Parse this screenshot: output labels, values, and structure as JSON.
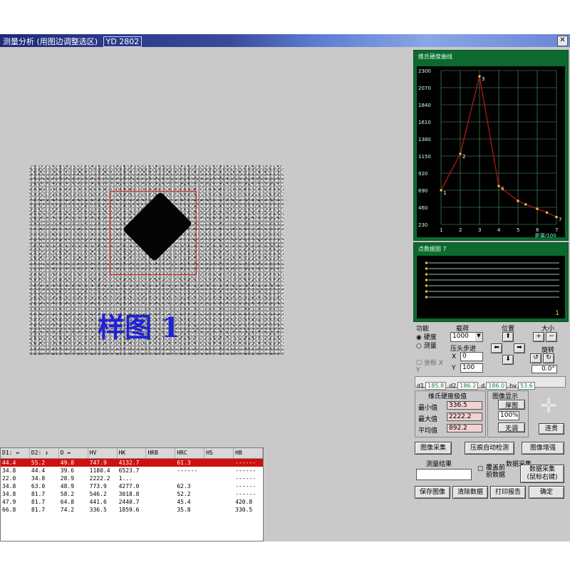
{
  "window": {
    "title": "测量分析 (用图边调整选区)",
    "model": "YD 2802",
    "close_label": "✕"
  },
  "sample": {
    "label": "样图 1"
  },
  "grid": {
    "columns": [
      "D1: ↔",
      "D2: ↕",
      "D ↔",
      "HV",
      "HK",
      "HRB",
      "HRC",
      "HS",
      "HB"
    ],
    "rows": [
      [
        "44.4",
        "55.2",
        "49.8",
        "747.9",
        "4132.7",
        "",
        "61.3",
        "",
        "------"
      ],
      [
        "34.8",
        "44.4",
        "39.6",
        "1180.4",
        "6523.7",
        "",
        "------",
        "",
        "------"
      ],
      [
        "22.0",
        "34.8",
        "28.9",
        "2222.2",
        "1...",
        "",
        "",
        "",
        "------"
      ],
      [
        "34.8",
        "63.0",
        "48.9",
        "773.9",
        "4277.0",
        "",
        "62.3",
        "",
        "------"
      ],
      [
        "34.8",
        "81.7",
        "58.2",
        "546.2",
        "3018.8",
        "",
        "52.2",
        "",
        "------"
      ],
      [
        "47.9",
        "81.7",
        "64.8",
        "441.6",
        "2440.7",
        "",
        "45.4",
        "",
        "420.8"
      ],
      [
        "66.8",
        "81.7",
        "74.2",
        "336.5",
        "1859.6",
        "",
        "35.8",
        "",
        "330.5"
      ]
    ]
  },
  "hardness_chart": {
    "caption": "维氏硬度曲线",
    "xlabel": "距离/100",
    "colors": {
      "panel": "#0c6a2e",
      "grid": "#4aa86a",
      "line": "#c01818",
      "point": "#f0d040"
    },
    "chart_data": {
      "type": "line",
      "x": [
        1,
        2,
        3,
        4,
        5,
        5.4,
        6,
        6.5,
        7
      ],
      "y": [
        690,
        1180,
        2222,
        748,
        546,
        500,
        440,
        390,
        330
      ],
      "point_labels": [
        "1",
        "2",
        "3",
        "4",
        "",
        "",
        "",
        "",
        "7"
      ],
      "xlim": [
        1,
        7
      ],
      "ylim": [
        230,
        2300
      ],
      "ytick_labels": [
        "2300",
        "2070",
        "1840",
        "1610",
        "1380",
        "1150",
        "920",
        "690",
        "460",
        "230"
      ],
      "xtick_labels": [
        "1",
        "2",
        "3",
        "4",
        "5",
        "6",
        "7"
      ],
      "grid": true
    }
  },
  "points_chart": {
    "caption": "点数据图 7",
    "corner_label": "1"
  },
  "controls": {
    "function_label": "功能",
    "radio_hardness": "硬度",
    "radio_measure": "测量",
    "load_label": "载荷",
    "load_value": "1000",
    "position_label": "位置",
    "size_label": "大小",
    "rotate_label": "旋转",
    "angle_value": "0.0°",
    "step_label": "压头步进",
    "step_x_label": "X",
    "step_x_value": "0",
    "step_y_label": "Y",
    "step_y_value": "100",
    "xy_label": "坐标 X Y"
  },
  "readouts": [
    {
      "label": "d1",
      "value": "185.8"
    },
    {
      "label": "d2",
      "value": "186.2"
    },
    {
      "label": "d",
      "value": "186.0"
    },
    {
      "label": "hv",
      "value": "53.6"
    }
  ],
  "stats": {
    "title": "维氏硬度极值",
    "min_label": "最小值",
    "min_value": "336.5",
    "max_label": "最大值",
    "max_value": "2222.2",
    "avg_label": "平均值",
    "avg_value": "892.2"
  },
  "display": {
    "title": "图像显示",
    "mode_thickness": "厚图",
    "zoom_value": "100%",
    "mode_none": "无调",
    "link_button": "连贯"
  },
  "buttons": {
    "capture": "图像采集",
    "auto_measure": "压痕自动检测",
    "image_enhance": "图像增强",
    "measure_result": "测量结果",
    "data_collect": "数据采集",
    "collect_two_line1": "数据采集",
    "collect_two_line2": "(鼠标右键)",
    "checkbox_label1": "覆盖前",
    "checkbox_label2": "前数据",
    "save_image": "保存图像",
    "clear_data": "清除数据",
    "print_report": "打印报告",
    "ok": "确定"
  }
}
